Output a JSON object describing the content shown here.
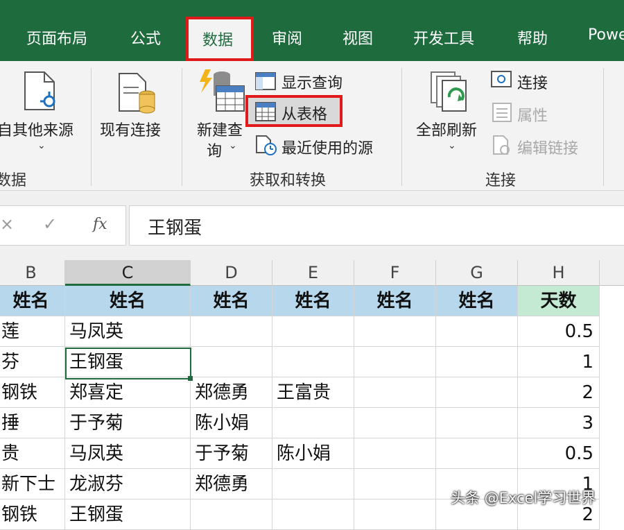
{
  "tabs": [
    "页面布局",
    "公式",
    "数据",
    "审阅",
    "视图",
    "开发工具",
    "帮助",
    "Powe"
  ],
  "ribbon": {
    "get_transform_group": {
      "from_other_sources": "自其他来源",
      "existing_connections": "现有连接",
      "new_query_line1": "新建查",
      "new_query_line2": "询",
      "show_queries": "显示查询",
      "from_table": "从表格",
      "recent_sources": "最近使用的源",
      "label_left": "数据",
      "label": "获取和转换"
    },
    "connections_group": {
      "refresh_all": "全部刷新",
      "connections": "连接",
      "properties": "属性",
      "edit_links": "编辑链接",
      "label": "连接"
    }
  },
  "formula_bar": {
    "cancel_symbol": "×",
    "confirm_symbol": "✓",
    "fx": "fx",
    "value": "王钢蛋"
  },
  "grid": {
    "column_headers": [
      "B",
      "C",
      "D",
      "E",
      "F",
      "G",
      "H"
    ],
    "rows": [
      [
        "姓名",
        "姓名",
        "姓名",
        "姓名",
        "姓名",
        "姓名",
        "天数"
      ],
      [
        "莲",
        "马凤英",
        "",
        "",
        "",
        "",
        "0.5"
      ],
      [
        "芬",
        "王钢蛋",
        "",
        "",
        "",
        "",
        "1"
      ],
      [
        "钢铁",
        "郑喜定",
        "郑德勇",
        "王富贵",
        "",
        "",
        "2"
      ],
      [
        "捶",
        "于予菊",
        "陈小娟",
        "",
        "",
        "",
        "3"
      ],
      [
        "贵",
        "马凤英",
        "于予菊",
        "陈小娟",
        "",
        "",
        "0.5"
      ],
      [
        "新下士",
        "龙淑芬",
        "郑德勇",
        "",
        "",
        "",
        "1"
      ],
      [
        "钢铁",
        "王钢蛋",
        "",
        "",
        "",
        "",
        "2"
      ]
    ]
  },
  "watermark": "头条 @Excel学习世界",
  "colors": {
    "ribbon_green": "#1e6b3e",
    "highlight_red": "#e01a1a",
    "header_blue": "#b7d7ec",
    "header_green": "#c5ead4"
  }
}
